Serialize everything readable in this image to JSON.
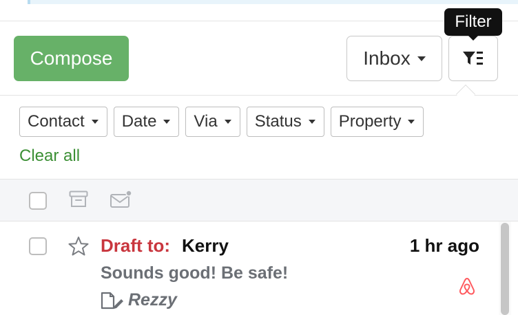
{
  "toolbar": {
    "compose_label": "Compose",
    "mailbox_label": "Inbox",
    "filter_tooltip": "Filter"
  },
  "filters": {
    "chips": [
      "Contact",
      "Date",
      "Via",
      "Status",
      "Property"
    ],
    "clear_all": "Clear all"
  },
  "bulk_actions": {
    "icons": [
      "archive-icon",
      "mark-unread-icon"
    ]
  },
  "messages": [
    {
      "draft_label": "Draft to:",
      "recipient": "Kerry",
      "time": "1 hr ago",
      "preview": "Sounds good! Be safe!",
      "via": "Rezzy",
      "channel_icon": "airbnb-icon"
    }
  ],
  "colors": {
    "compose_green": "#67b168",
    "link_green": "#3b8f34",
    "draft_red": "#c9363e",
    "airbnb_red": "#ff5a5f",
    "tooltip_bg": "#111111"
  }
}
